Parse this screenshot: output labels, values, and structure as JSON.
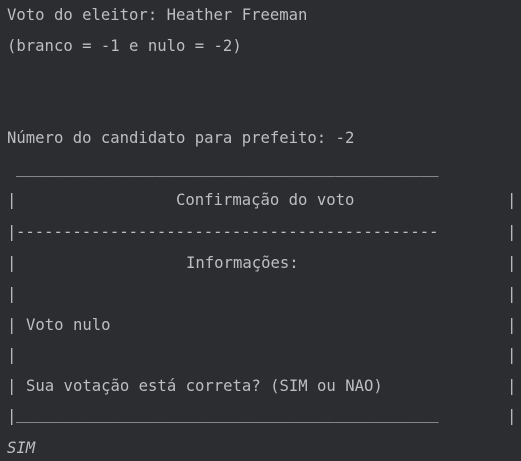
{
  "console": {
    "voter_line": "Voto do eleitor: Heather Freeman",
    "hint_line": "(branco = -1 e nulo = -2)",
    "candidate_prompt": "Número do candidato para prefeito: -2",
    "box": {
      "top_border": "_____________________________________________",
      "title": "Confirmação do voto",
      "separator": "---------------------------------------------",
      "section_label": "Informações:",
      "vote_status": "Voto nulo",
      "question": "Sua votação está correta? (SIM ou NAO)",
      "bottom_border": "_____________________________________________",
      "pipe": "|"
    },
    "user_input": "SIM"
  }
}
